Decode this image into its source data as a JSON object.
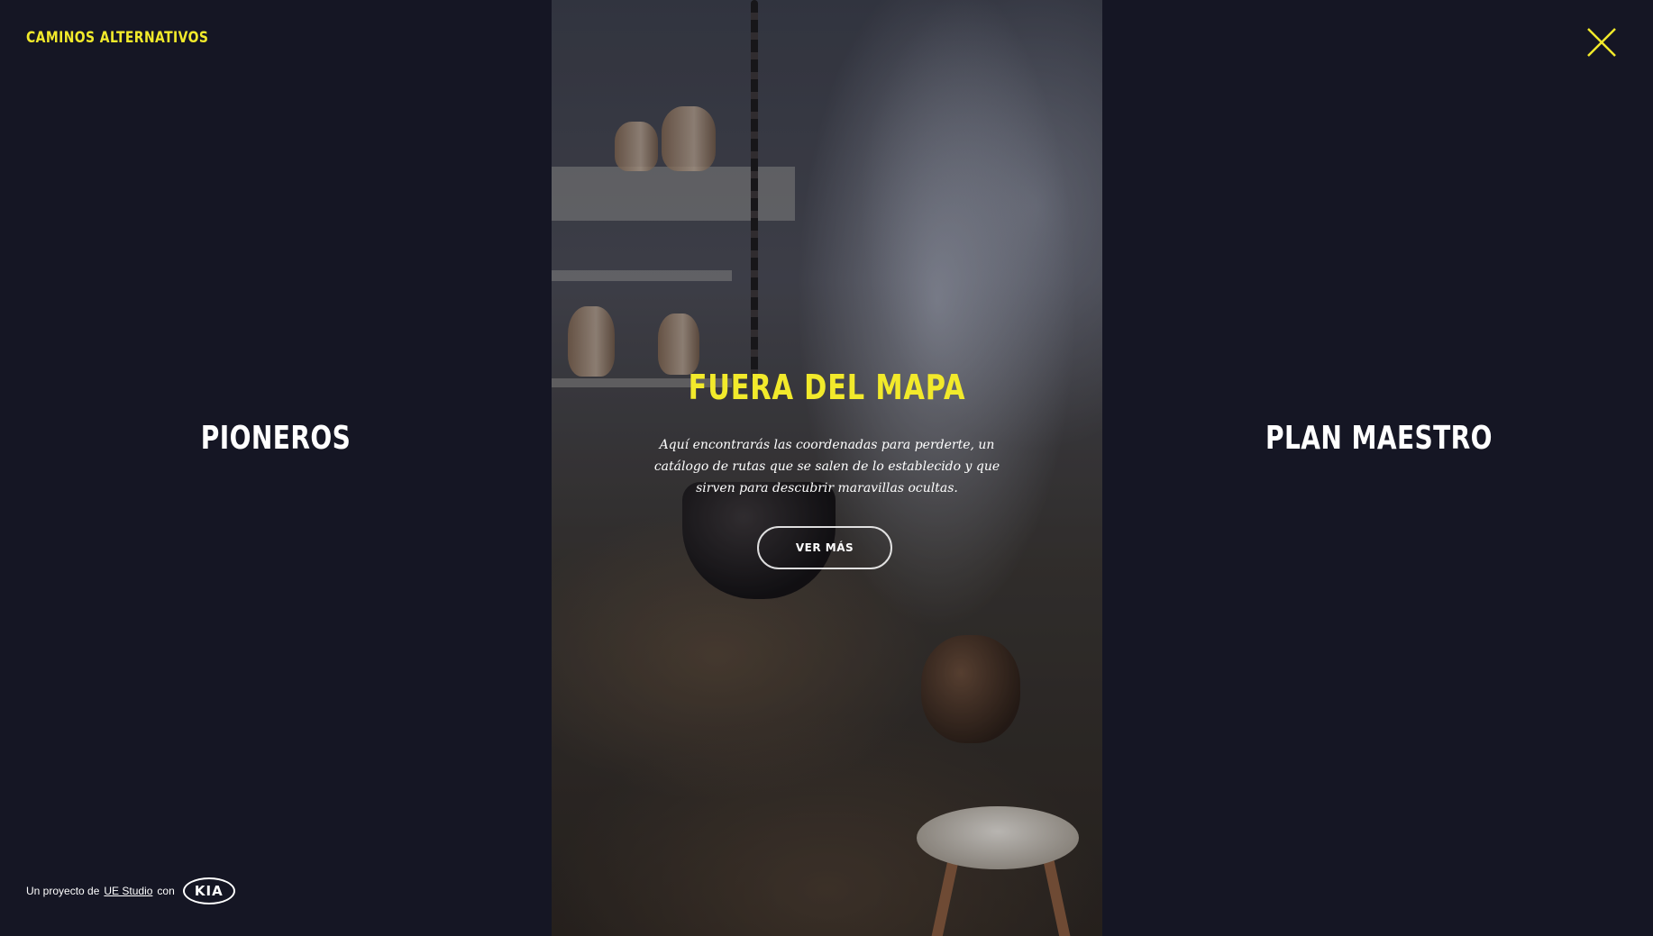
{
  "brand": {
    "logo_text": "CAMINOS ALTERNATIVOS",
    "accent_color": "#f2ea2b",
    "background_color": "#151624"
  },
  "header": {
    "close_icon": "close-icon"
  },
  "sections": {
    "left": {
      "title": "PIONEROS"
    },
    "center": {
      "title": "FUERA DEL MAPA",
      "description": "Aquí encontrarás las coordenadas para perderte, un catálogo de rutas que se salen de lo establecido y que sirven para descubrir maravillas ocultas.",
      "button_label": "VER MÁS",
      "background_image": "smoky rustic kitchen with hanging cauldron"
    },
    "right": {
      "title": "PLAN MAESTRO"
    }
  },
  "footer": {
    "prefix": "Un proyecto de",
    "studio_link": "UE Studio",
    "connector": "con",
    "partner_logo_text": "KIA"
  }
}
